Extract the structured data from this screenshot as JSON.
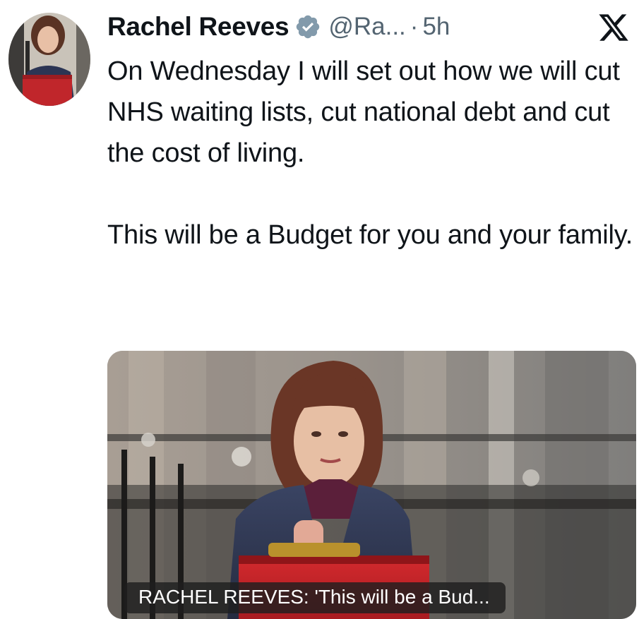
{
  "tweet": {
    "author": {
      "display_name": "Rachel Reeves",
      "verified_icon": "verified-badge-icon",
      "handle": "@Ra...",
      "separator": "·",
      "time": "5h"
    },
    "platform_icon": "x-logo-icon",
    "text_paragraphs": [
      "On Wednesday I will set out how we will cut NHS waiting lists, cut national debt and cut the cost of living.",
      "This will be a Budget for you and your family."
    ],
    "media": {
      "caption": "RACHEL REEVES: 'This will be a Bud..."
    }
  },
  "colors": {
    "text": "#0f1419",
    "secondary": "#536471",
    "verified_badge": "#829aab",
    "budget_box_red": "#c42126"
  }
}
